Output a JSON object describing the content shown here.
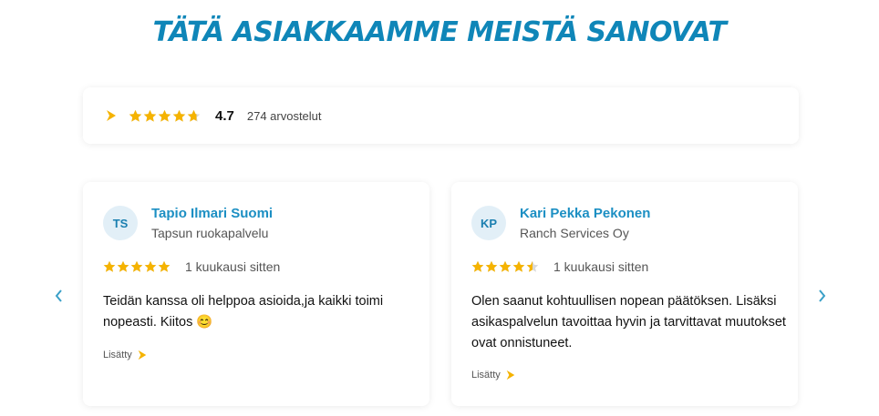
{
  "heading": "TÄTÄ ASIAKKAAMME MEISTÄ SANOVAT",
  "summary": {
    "brand_icon": "play-logo-icon",
    "stars": 4.7,
    "rating": "4.7",
    "count_text": "274 arvostelut"
  },
  "reviews": [
    {
      "initials": "TS",
      "name": "Tapio Ilmari Suomi",
      "company": "Tapsun ruokapalvelu",
      "stars": 5,
      "time": "1 kuukausi sitten",
      "text": "Teidän kanssa oli helppoa asioida,ja kaikki toimi nopeasti. Kiitos 😊",
      "added_label": "Lisätty"
    },
    {
      "initials": "KP",
      "name": "Kari Pekka Pekonen",
      "company": "Ranch Services Oy",
      "stars": 4.5,
      "time": "1 kuukausi sitten",
      "text": "Olen saanut kohtuullisen nopean päätöksen. Lisäksi asikaspalvelun tavoittaa hyvin ja tarvittavat muutokset ovat onnistuneet.",
      "added_label": "Lisätty"
    }
  ],
  "colors": {
    "heading": "#0f86b8",
    "star": "#f5b301",
    "accent": "#1c8fc3",
    "brand": "#f5b301"
  }
}
